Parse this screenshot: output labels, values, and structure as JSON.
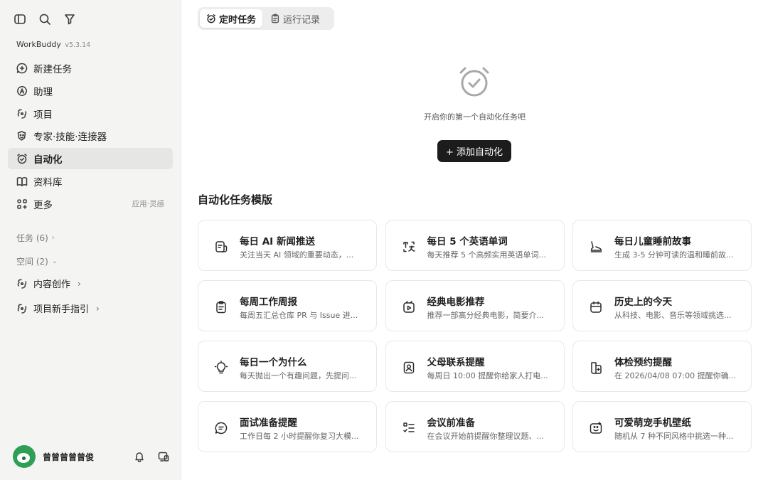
{
  "app": {
    "name": "WorkBuddy",
    "version": "v5.3.14"
  },
  "sidebar": {
    "nav": [
      {
        "label": "新建任务",
        "icon": "plus-circle-icon"
      },
      {
        "label": "助理",
        "icon": "assistant-icon"
      },
      {
        "label": "项目",
        "icon": "project-icon"
      },
      {
        "label": "专家·技能·连接器",
        "icon": "expert-icon"
      },
      {
        "label": "自动化",
        "icon": "alarm-icon",
        "active": true
      },
      {
        "label": "资料库",
        "icon": "book-icon"
      },
      {
        "label": "更多",
        "icon": "grid-icon",
        "hint": "应用·灵感"
      }
    ],
    "tasks_section": "任务 (6)",
    "spaces_section": "空间 (2)",
    "spaces": [
      {
        "label": "内容创作"
      },
      {
        "label": "项目新手指引"
      }
    ],
    "user": {
      "name": "曾曾曾曾曾俊",
      "avatar_color": "#2f9e57"
    }
  },
  "main": {
    "tabs": [
      {
        "label": "定时任务",
        "active": true
      },
      {
        "label": "运行记录"
      }
    ],
    "empty_text": "开启你的第一个自动化任务吧",
    "add_button": "+ 添加自动化",
    "templates_title": "自动化任务模版",
    "templates": [
      {
        "title": "每日 AI 新闻推送",
        "desc": "关注当天 AI 领域的重要动态，...",
        "icon": "news-icon"
      },
      {
        "title": "每日 5 个英语单词",
        "desc": "每天推荐 5 个高频实用英语单词...",
        "icon": "translate-icon"
      },
      {
        "title": "每日儿童睡前故事",
        "desc": "生成 3-5 分钟可读的温和睡前故...",
        "icon": "boot-icon"
      },
      {
        "title": "每周工作周报",
        "desc": "每周五汇总仓库 PR 与 Issue 进...",
        "icon": "clipboard-icon"
      },
      {
        "title": "经典电影推荐",
        "desc": "推荐一部高分经典电影，简要介...",
        "icon": "film-icon"
      },
      {
        "title": "历史上的今天",
        "desc": "从科技、电影、音乐等领域挑选...",
        "icon": "calendar-icon"
      },
      {
        "title": "每日一个为什么",
        "desc": "每天抛出一个有趣问题，先提问...",
        "icon": "lightbulb-icon"
      },
      {
        "title": "父母联系提醒",
        "desc": "每周日 10:00 提醒你给家人打电...",
        "icon": "contact-icon"
      },
      {
        "title": "体检预约提醒",
        "desc": "在 2026/04/08 07:00 提醒你确...",
        "icon": "health-icon"
      },
      {
        "title": "面试准备提醒",
        "desc": "工作日每 2 小时提醒你复习大模...",
        "icon": "chat-icon"
      },
      {
        "title": "会议前准备",
        "desc": "在会议开始前提醒你整理议题、...",
        "icon": "checklist-icon"
      },
      {
        "title": "可爱萌宠手机壁纸",
        "desc": "随机从 7 种不同风格中挑选一种...",
        "icon": "wallpaper-icon"
      }
    ]
  }
}
